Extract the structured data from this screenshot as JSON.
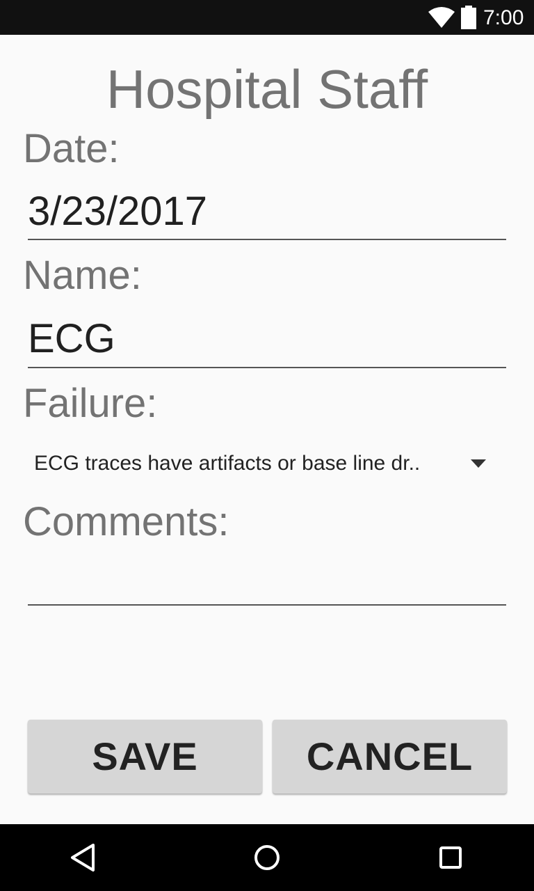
{
  "status_bar": {
    "time": "7:00",
    "wifi_icon": "wifi-icon",
    "battery_icon": "battery-icon"
  },
  "form": {
    "title": "Hospital Staff",
    "date_label": "Date:",
    "date_value": "3/23/2017",
    "name_label": "Name:",
    "name_value": "ECG",
    "failure_label": "Failure:",
    "failure_selected": "ECG traces have artifacts or base line dr..",
    "comments_label": "Comments:",
    "comments_value": ""
  },
  "buttons": {
    "save_label": "SAVE",
    "cancel_label": "CANCEL"
  },
  "nav_bar": {
    "back_icon": "back-triangle-icon",
    "home_icon": "home-circle-icon",
    "recents_icon": "recents-square-icon"
  },
  "colors": {
    "status_bar": "#111111",
    "background": "#fafafa",
    "label_text": "#737373",
    "button_bg": "#d6d6d6",
    "nav_bar": "#000000"
  }
}
